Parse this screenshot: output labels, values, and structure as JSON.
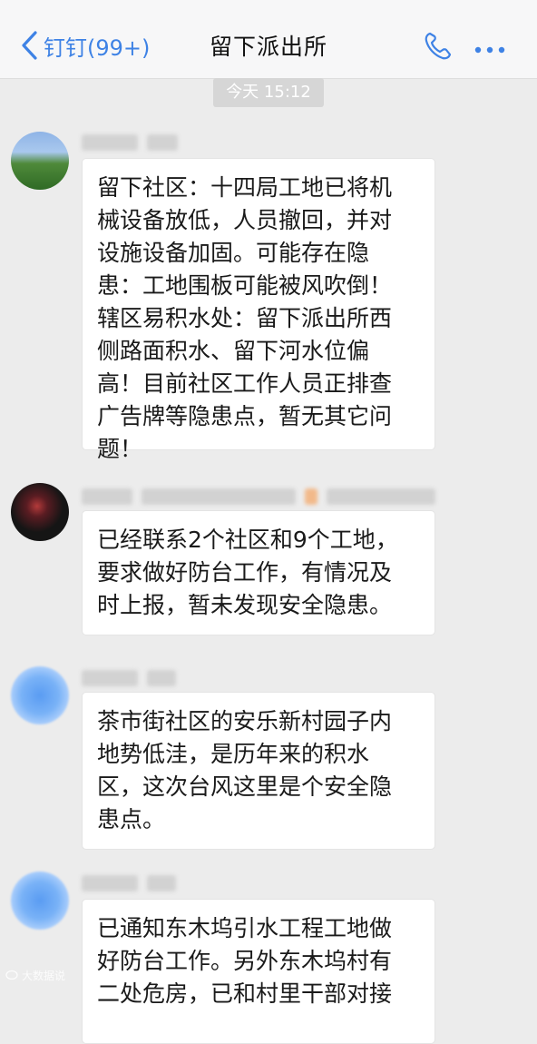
{
  "navbar": {
    "back_label": "钉钉(99+)",
    "title": "留下派出所"
  },
  "timestamp": "今天 15:12",
  "messages": [
    {
      "lines": [
        "留下社区：十四局工地已将机",
        "械设备放低，人员撤回，并对",
        "设施设备加固。可能存在隐",
        "患：工地围板可能被风吹倒！",
        "辖区易积水处：留下派出所西",
        "侧路面积水、留下河水位偏",
        "高！目前社区工作人员正排查",
        "广告牌等隐患点，暂无其它问",
        "题！"
      ]
    },
    {
      "lines": [
        "已经联系2个社区和9个工地，",
        "要求做好防台工作，有情况及",
        "时上报，暂未发现安全隐患。"
      ]
    },
    {
      "lines": [
        "茶市街社区的安乐新村园子内",
        "地势低洼，是历年来的积水",
        "区，这次台风这里是个安全隐",
        "患点。"
      ]
    },
    {
      "lines": [
        "已通知东木坞引水工程工地做",
        "好防台工作。另外东木坞村有",
        "二处危房，已和村里干部对接"
      ]
    }
  ],
  "watermark": "大数据说",
  "colors": {
    "accent": "#3e82e5",
    "background": "#ececec",
    "bubble": "#ffffff"
  }
}
